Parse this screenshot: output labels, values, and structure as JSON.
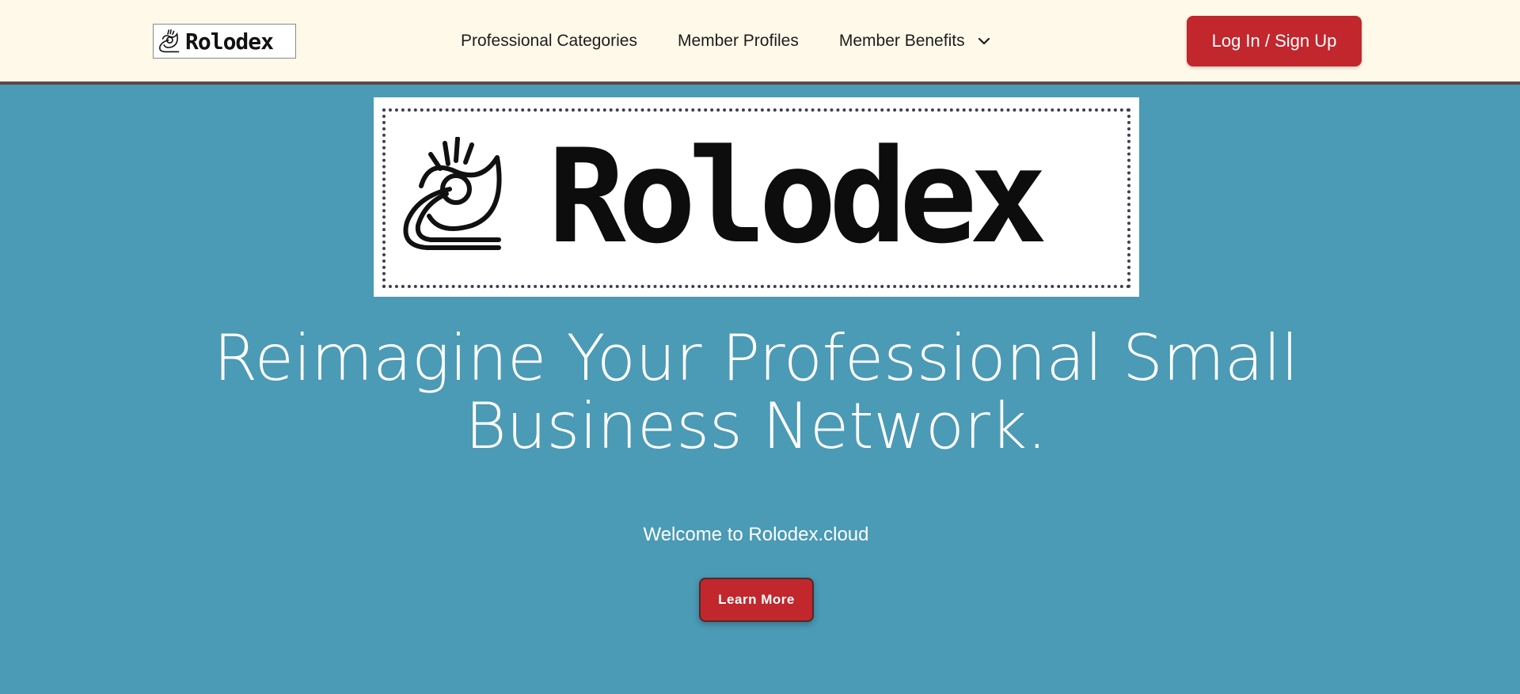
{
  "header": {
    "logo_text": "Rolodex",
    "logo_icon": "rolodex-snail-icon",
    "nav": [
      {
        "label": "Professional Categories"
      },
      {
        "label": "Member Profiles"
      },
      {
        "label": "Member Benefits",
        "icon": "chevron-down-icon"
      }
    ],
    "login_label": "Log In / Sign Up"
  },
  "hero": {
    "logo_text": "Rolodex",
    "heading_line1": "Reimagine Your Professional Small",
    "heading_line2": "Business Network.",
    "welcome": "Welcome to Rolodex.cloud",
    "cta_label": "Learn More"
  },
  "colors": {
    "header_bg": "#fef9e8",
    "hero_bg": "#4b9ab6",
    "accent_red": "#c1272d",
    "header_border": "#5a4a46"
  }
}
